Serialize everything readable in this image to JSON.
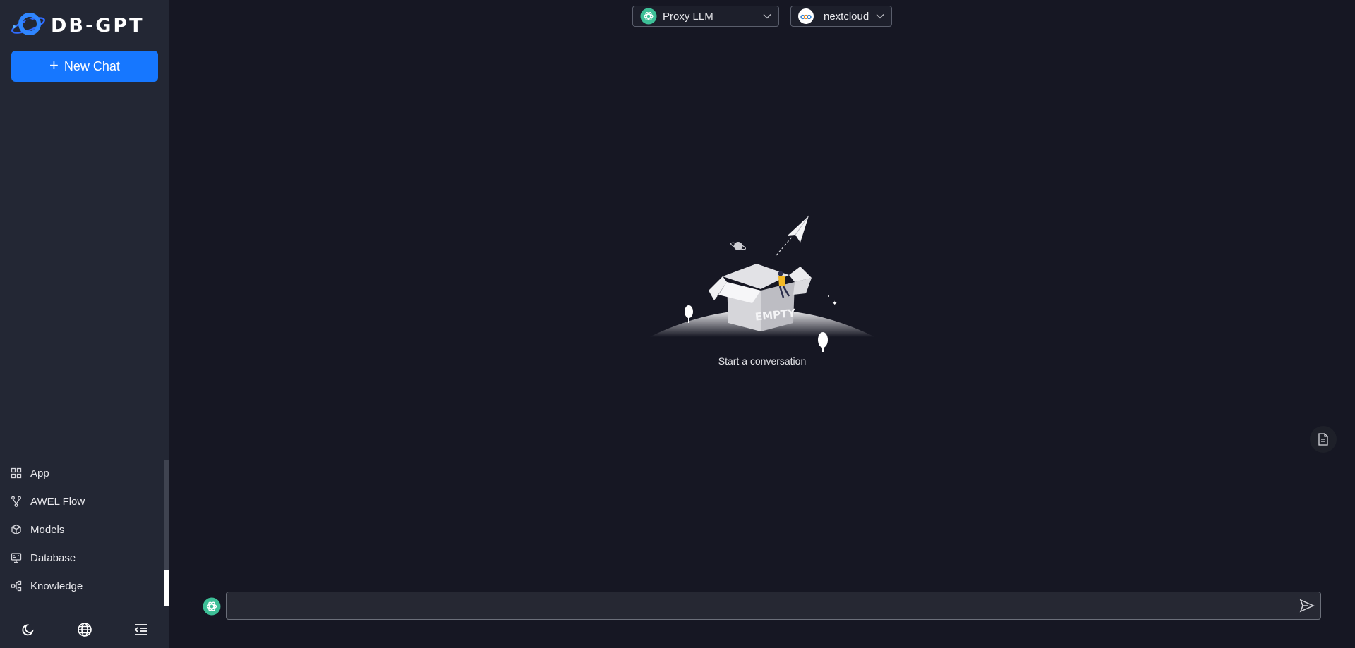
{
  "app": {
    "logo_text": "DB-GPT"
  },
  "sidebar": {
    "new_chat_label": "New Chat",
    "items": [
      {
        "label": "App",
        "icon": "grid-icon"
      },
      {
        "label": "AWEL Flow",
        "icon": "flow-icon"
      },
      {
        "label": "Models",
        "icon": "cube-icon"
      },
      {
        "label": "Database",
        "icon": "database-icon"
      },
      {
        "label": "Knowledge",
        "icon": "knowledge-icon"
      }
    ],
    "bottom_icons": [
      "moon-icon",
      "globe-icon",
      "collapse-menu-icon"
    ]
  },
  "header": {
    "model_select": {
      "value": "Proxy LLM",
      "icon": "openai-icon"
    },
    "space_select": {
      "value": "nextcloud",
      "icon": "nextcloud-logo-icon"
    }
  },
  "main": {
    "empty_state_text": "Start a conversation",
    "empty_illustration_text": "EMPTY"
  },
  "input": {
    "value": "",
    "placeholder": ""
  },
  "colors": {
    "accent": "#1677ff",
    "background": "#161723",
    "sidebar": "#232734",
    "openai_green": "#3dbf97"
  }
}
